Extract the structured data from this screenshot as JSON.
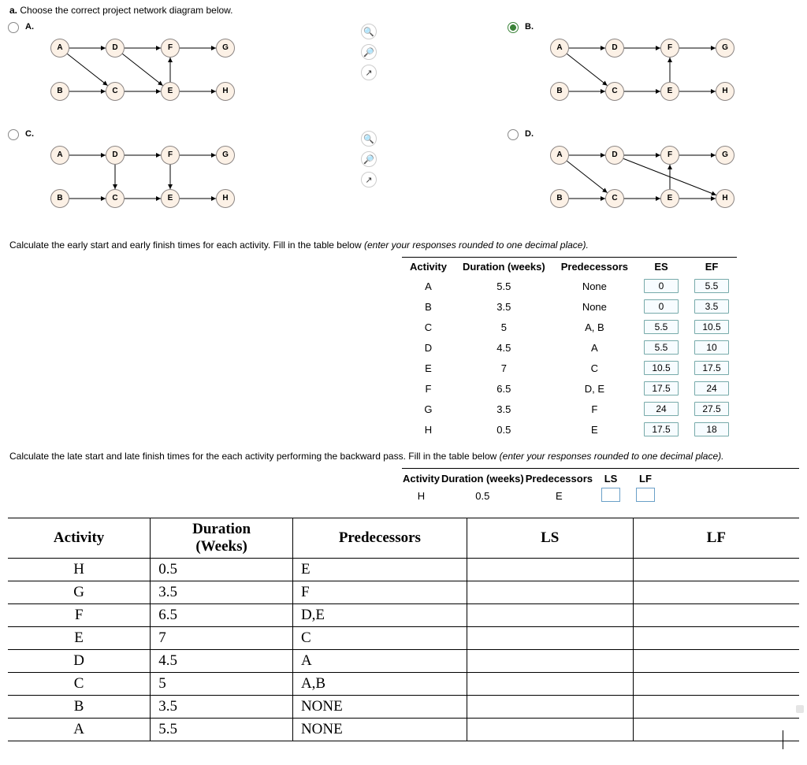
{
  "question_label": "a.",
  "question_text": "Choose the correct project network diagram below.",
  "choices": [
    {
      "letter": "A.",
      "selected": false
    },
    {
      "letter": "B.",
      "selected": true
    },
    {
      "letter": "C.",
      "selected": false
    },
    {
      "letter": "D.",
      "selected": false
    }
  ],
  "nodes": [
    "A",
    "B",
    "C",
    "D",
    "E",
    "F",
    "G",
    "H"
  ],
  "tools": [
    "zoom-in-icon",
    "zoom-out-icon",
    "popout-icon"
  ],
  "instr1_a": "Calculate the early start and early finish times for each activity. Fill in the table below ",
  "instr1_b": "(enter your responses rounded to one decimal place).",
  "es_table": {
    "headers": [
      "Activity",
      "Duration (weeks)",
      "Predecessors",
      "ES",
      "EF"
    ],
    "rows": [
      {
        "act": "A",
        "dur": "5.5",
        "pred": "None",
        "es": "0",
        "ef": "5.5"
      },
      {
        "act": "B",
        "dur": "3.5",
        "pred": "None",
        "es": "0",
        "ef": "3.5"
      },
      {
        "act": "C",
        "dur": "5",
        "pred": "A, B",
        "es": "5.5",
        "ef": "10.5"
      },
      {
        "act": "D",
        "dur": "4.5",
        "pred": "A",
        "es": "5.5",
        "ef": "10"
      },
      {
        "act": "E",
        "dur": "7",
        "pred": "C",
        "es": "10.5",
        "ef": "17.5"
      },
      {
        "act": "F",
        "dur": "6.5",
        "pred": "D, E",
        "es": "17.5",
        "ef": "24"
      },
      {
        "act": "G",
        "dur": "3.5",
        "pred": "F",
        "es": "24",
        "ef": "27.5"
      },
      {
        "act": "H",
        "dur": "0.5",
        "pred": "E",
        "es": "17.5",
        "ef": "18"
      }
    ]
  },
  "instr2_a": "Calculate the late start and late finish times for the each activity performing the backward pass. Fill in the table below ",
  "instr2_b": "(enter your responses rounded to one decimal place).",
  "ls_header": [
    "Activity",
    "Duration (weeks)",
    "Predecessors",
    "LS",
    "LF"
  ],
  "ls_row": {
    "act": "H",
    "dur": "0.5",
    "pred": "E"
  },
  "big_table": {
    "headers": [
      "Activity",
      "Duration (Weeks)",
      "Predecessors",
      "LS",
      "LF"
    ],
    "rows": [
      {
        "act": "H",
        "dur": "0.5",
        "pred": "E"
      },
      {
        "act": "G",
        "dur": "3.5",
        "pred": "F"
      },
      {
        "act": "F",
        "dur": "6.5",
        "pred": "D,E"
      },
      {
        "act": "E",
        "dur": "7",
        "pred": "C"
      },
      {
        "act": "D",
        "dur": "4.5",
        "pred": "A"
      },
      {
        "act": "C",
        "dur": "5",
        "pred": "A,B"
      },
      {
        "act": "B",
        "dur": "3.5",
        "pred": "NONE"
      },
      {
        "act": "A",
        "dur": "5.5",
        "pred": "NONE"
      }
    ]
  }
}
